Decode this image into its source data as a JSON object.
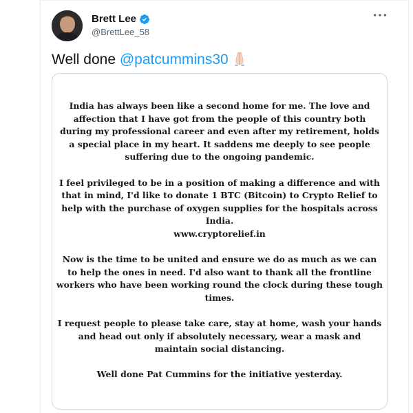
{
  "tweet": {
    "author": {
      "display_name": "Brett Lee",
      "handle": "@BrettLee_58",
      "verified": true
    },
    "more_icon": "more-horizontal-icon",
    "text_prefix": "Well done ",
    "mention": "@patcummins30",
    "emoji": "folded-hands-icon",
    "colors": {
      "mention": "#1d9bf0",
      "verified": "#1d9bf0",
      "handle": "#536471"
    }
  },
  "media": {
    "paragraphs": [
      "India has always been like a second home for me. The love and affection that I have got from the people of this country both during my professional career and even after my retirement, holds a special place in my heart. It saddens me deeply to see people suffering due to the ongoing pandemic.",
      "I feel privileged to be in a position of making a difference and with that in mind, I'd like to donate 1 BTC (Bitcoin) to Crypto Relief to help with the purchase of oxygen supplies for the hospitals across India.",
      "Now is the time to be united and ensure we do as much as we can to help the ones in need. I'd also want to thank all the frontline workers who have been working round the clock during these tough times.",
      "I request people to please take care, stay at home, wash your hands and head out only if absolutely necessary, wear a mask and maintain social distancing.",
      "Well done Pat Cummins for the initiative yesterday."
    ],
    "link": "www.cryptorelief.in"
  }
}
